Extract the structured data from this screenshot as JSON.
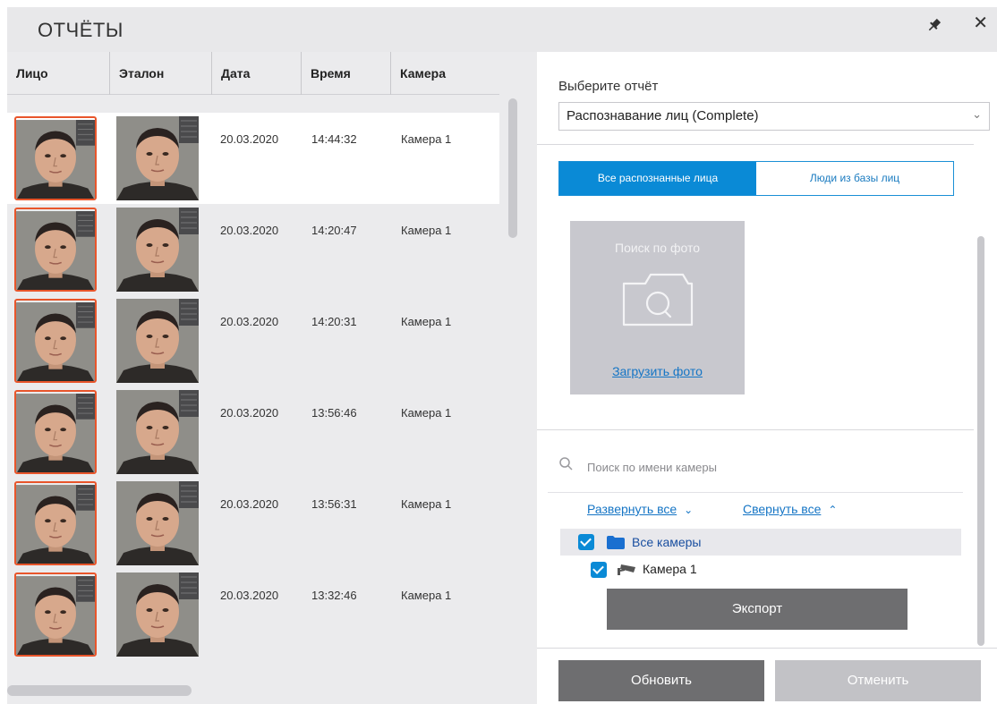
{
  "header": {
    "title": "ОТЧЁТЫ",
    "pin_icon": "pin-icon",
    "close_label": "✕"
  },
  "table": {
    "columns": [
      "Лицо",
      "Эталон",
      "Дата",
      "Время",
      "Камера"
    ],
    "rows": [
      {
        "date": "20.03.2020",
        "time": "14:44:32",
        "camera": "Камера 1",
        "selected": true
      },
      {
        "date": "20.03.2020",
        "time": "14:20:47",
        "camera": "Камера 1",
        "selected": false
      },
      {
        "date": "20.03.2020",
        "time": "14:20:31",
        "camera": "Камера 1",
        "selected": false
      },
      {
        "date": "20.03.2020",
        "time": "13:56:46",
        "camera": "Камера 1",
        "selected": false
      },
      {
        "date": "20.03.2020",
        "time": "13:56:31",
        "camera": "Камера 1",
        "selected": false
      },
      {
        "date": "20.03.2020",
        "time": "13:32:46",
        "camera": "Камера 1",
        "selected": false
      }
    ]
  },
  "report": {
    "label": "Выберите отчёт",
    "selected": "Распознавание лиц (Complete)"
  },
  "tabs": {
    "all": "Все распознанные лица",
    "db": "Люди из базы лиц",
    "active": "all"
  },
  "photo_search": {
    "title": "Поиск по фото",
    "upload": "Загрузить фото",
    "icon": "camera-icon"
  },
  "camera_search": {
    "placeholder": "Поиск по имени камеры"
  },
  "tree": {
    "expand_all": "Развернуть все",
    "collapse_all": "Свернуть все",
    "all_cameras": "Все камеры",
    "camera_1": "Камера 1"
  },
  "buttons": {
    "export": "Экспорт",
    "refresh": "Обновить",
    "cancel": "Отменить"
  },
  "colors": {
    "accent": "#0a8ad6",
    "face_border": "#e8552b",
    "button_dark": "#6e6e70",
    "button_disabled": "#c2c2c6"
  }
}
